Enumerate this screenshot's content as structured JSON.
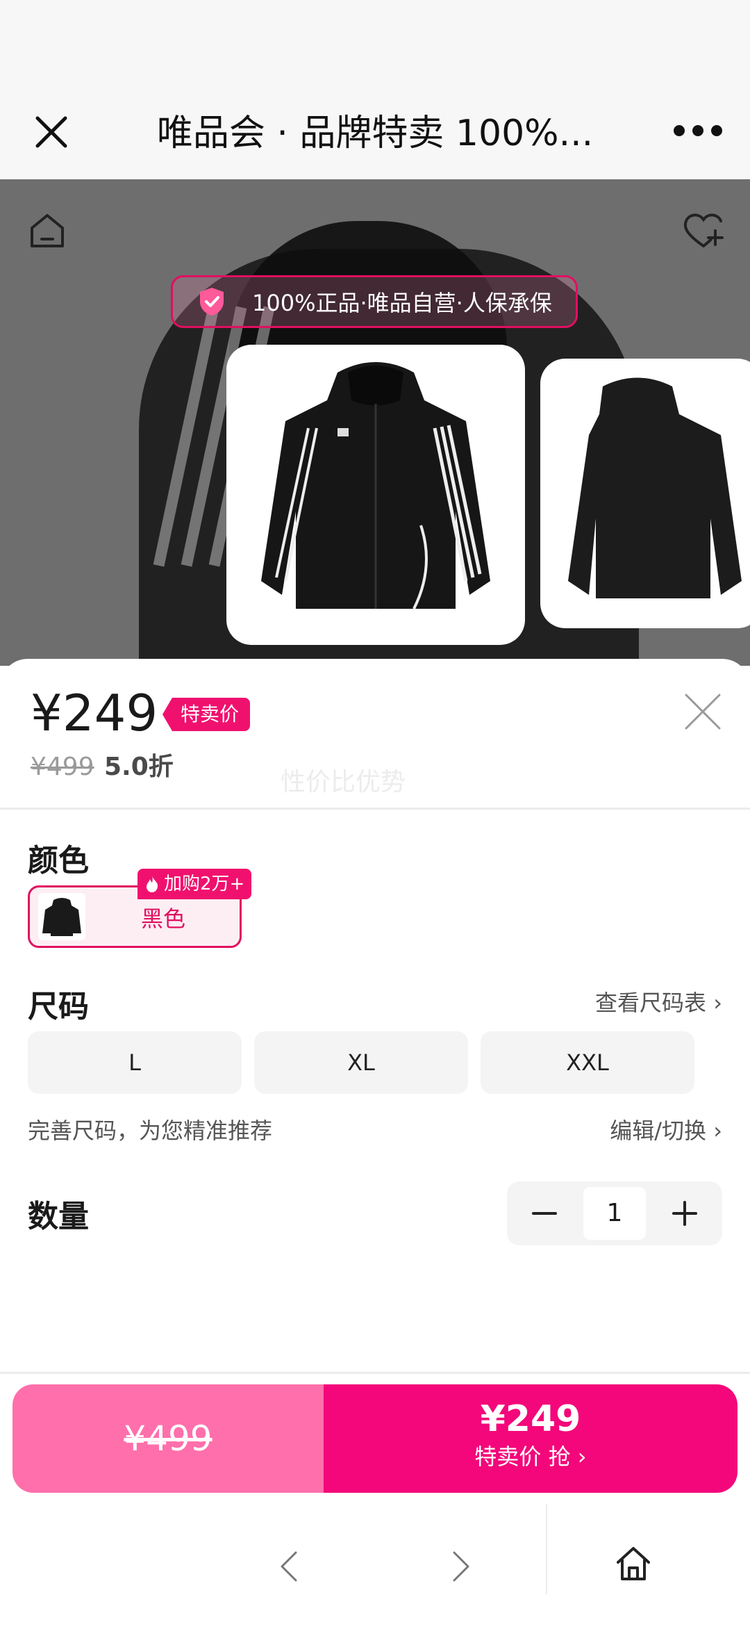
{
  "topbar": {
    "title": "唯品会 · 品牌特卖 100%...",
    "close_icon": "close-icon",
    "more_icon": "more-icon"
  },
  "hero": {
    "badge_text": "100%正品·唯品自营·人保承保",
    "home_icon": "home-icon",
    "favorite_icon": "favorite-add-icon"
  },
  "sheet": {
    "price": "¥249",
    "price_tag": "特卖价",
    "original_price": "¥499",
    "discount": "5.0折",
    "watermark": "性价比优势",
    "color_label": "颜色",
    "color_option": "黑色",
    "hot_tag": "加购2万+",
    "size_label": "尺码",
    "size_chart_link": "查看尺码表",
    "sizes": [
      "L",
      "XL",
      "XXL"
    ],
    "size_tip": "完善尺码，为您精准推荐",
    "size_edit": "编辑/切换",
    "quantity_label": "数量",
    "quantity": "1"
  },
  "buy_bar": {
    "original": "¥499",
    "price": "¥249",
    "action": "特卖价 抢"
  },
  "colors": {
    "accent": "#f0116e",
    "accent_light": "#ff6fab"
  }
}
